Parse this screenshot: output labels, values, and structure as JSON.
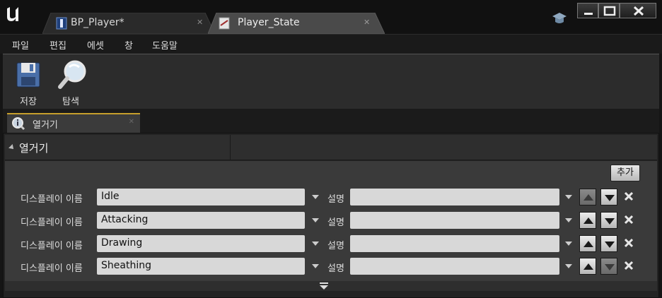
{
  "tabs": [
    {
      "label": "BP_Player*",
      "icon": "blueprint-icon",
      "active": false
    },
    {
      "label": "Player_State",
      "icon": "enum-document-icon",
      "active": true
    }
  ],
  "menu": [
    "파일",
    "편집",
    "에셋",
    "창",
    "도움말"
  ],
  "toolbar": {
    "save_label": "저장",
    "browse_label": "탐색"
  },
  "panel_tab": {
    "label": "열거기",
    "icon": "info-icon"
  },
  "category": {
    "title": "열거기"
  },
  "add_label": "추가",
  "row_label": "디스플레이 이름",
  "desc_label": "설명",
  "enumerators": [
    {
      "name": "Idle",
      "description": "",
      "move_up_enabled": false,
      "move_down_enabled": true
    },
    {
      "name": "Attacking",
      "description": "",
      "move_up_enabled": true,
      "move_down_enabled": true
    },
    {
      "name": "Drawing",
      "description": "",
      "move_up_enabled": true,
      "move_down_enabled": true
    },
    {
      "name": "Sheathing",
      "description": "",
      "move_up_enabled": true,
      "move_down_enabled": false
    }
  ],
  "colors": {
    "accent": "#c69e2b",
    "background": "#151515",
    "panel": "#3a3a3a"
  }
}
